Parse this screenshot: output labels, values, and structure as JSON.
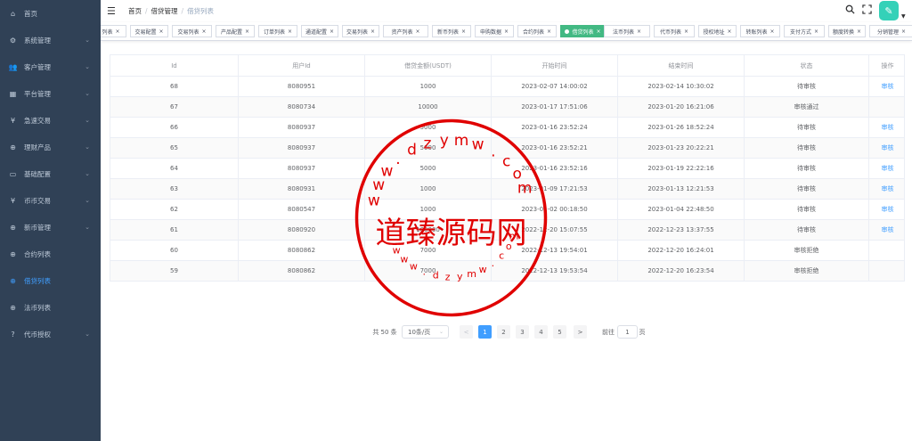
{
  "sidebar": {
    "items": [
      {
        "label": "首页",
        "icon": "home-icon",
        "glyph": "⌂",
        "chevron": false
      },
      {
        "label": "系统管理",
        "icon": "gear-icon",
        "glyph": "⚙",
        "chevron": true
      },
      {
        "label": "客户管理",
        "icon": "users-icon",
        "glyph": "👥",
        "chevron": true
      },
      {
        "label": "平台管理",
        "icon": "grid-icon",
        "glyph": "▦",
        "chevron": true
      },
      {
        "label": "急速交易",
        "icon": "yen-icon",
        "glyph": "¥",
        "chevron": true
      },
      {
        "label": "理财产品",
        "icon": "product-icon",
        "glyph": "⊕",
        "chevron": true
      },
      {
        "label": "基础配置",
        "icon": "book-icon",
        "glyph": "▭",
        "chevron": true
      },
      {
        "label": "币币交易",
        "icon": "yen-icon",
        "glyph": "¥",
        "chevron": true
      },
      {
        "label": "新币管理",
        "icon": "coin-icon",
        "glyph": "⊕",
        "chevron": true
      },
      {
        "label": "合约列表",
        "icon": "contract-icon",
        "glyph": "⊕",
        "chevron": false
      },
      {
        "label": "借贷列表",
        "icon": "loan-icon",
        "glyph": "⊕",
        "chevron": false,
        "active": true
      },
      {
        "label": "法币列表",
        "icon": "fiat-icon",
        "glyph": "⊕",
        "chevron": false
      },
      {
        "label": "代币授权",
        "icon": "question-icon",
        "glyph": "?",
        "chevron": true
      }
    ]
  },
  "breadcrumb": {
    "home": "首页",
    "parent": "借贷管理",
    "current": "借贷列表"
  },
  "tags": [
    {
      "label": "列表"
    },
    {
      "label": "交易配置"
    },
    {
      "label": "交易列表"
    },
    {
      "label": "产品配置"
    },
    {
      "label": "订单列表"
    },
    {
      "label": "通道配置"
    },
    {
      "label": "交易列表"
    },
    {
      "label": "资产列表"
    },
    {
      "label": "新币列表"
    },
    {
      "label": "申购数据"
    },
    {
      "label": "合约列表"
    },
    {
      "label": "借贷列表",
      "active": true
    },
    {
      "label": "法币列表"
    },
    {
      "label": "代币列表"
    },
    {
      "label": "授权地址"
    },
    {
      "label": "转账列表"
    },
    {
      "label": "支付方式"
    },
    {
      "label": "额度转换"
    },
    {
      "label": "分销管理"
    }
  ],
  "table": {
    "headers": [
      "Id",
      "用户Id",
      "借贷金额(USDT)",
      "开始时间",
      "结束时间",
      "状态",
      "操作"
    ],
    "rows": [
      [
        "68",
        "8080951",
        "1000",
        "2023-02-07 14:00:02",
        "2023-02-14 10:30:02",
        "待审核",
        "审核"
      ],
      [
        "67",
        "8080734",
        "10000",
        "2023-01-17 17:51:06",
        "2023-01-20 16:21:06",
        "审核通过",
        ""
      ],
      [
        "66",
        "8080937",
        "5000",
        "2023-01-16 23:52:24",
        "2023-01-26 18:52:24",
        "待审核",
        "审核"
      ],
      [
        "65",
        "8080937",
        "5000",
        "2023-01-16 23:52:21",
        "2023-01-23 20:22:21",
        "待审核",
        "审核"
      ],
      [
        "64",
        "8080937",
        "5000",
        "2023-01-16 23:52:16",
        "2023-01-19 22:22:16",
        "待审核",
        "审核"
      ],
      [
        "63",
        "8080931",
        "1000",
        "2023-01-09 17:21:53",
        "2023-01-13 12:21:53",
        "待审核",
        "审核"
      ],
      [
        "62",
        "8080547",
        "1000",
        "2023-01-02 00:18:50",
        "2023-01-04 22:48:50",
        "待审核",
        "审核"
      ],
      [
        "61",
        "8080920",
        "100000",
        "2022-12-20 15:07:55",
        "2022-12-23 13:37:55",
        "待审核",
        "审核"
      ],
      [
        "60",
        "8080862",
        "7000",
        "2022-12-13 19:54:01",
        "2022-12-20 16:24:01",
        "审核拒绝",
        ""
      ],
      [
        "59",
        "8080862",
        "7000",
        "2022-12-13 19:53:54",
        "2022-12-20 16:23:54",
        "审核拒绝",
        ""
      ]
    ]
  },
  "pagination": {
    "total": "共 50 条",
    "page_size": "10条/页",
    "prev": "<",
    "next": ">",
    "pages": [
      "1",
      "2",
      "3",
      "4",
      "5"
    ],
    "current": "1",
    "goto_label": "前往",
    "goto_value": "1",
    "goto_suffix": "页"
  },
  "watermark": {
    "center_text": "道臻源码网",
    "arc_text_top": "www.dzymw.com",
    "arc_text_bottom": "www.dzymw.com",
    "color": "#e00000"
  }
}
